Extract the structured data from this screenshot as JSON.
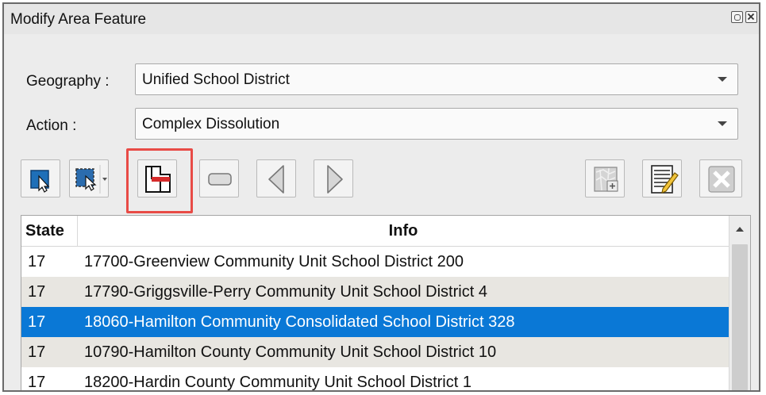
{
  "window": {
    "title": "Modify Area Feature",
    "float_icon": "float-icon",
    "close_icon": "close-icon"
  },
  "form": {
    "geography_label": "Geography :",
    "geography_value": "Unified School District",
    "action_label": "Action :",
    "action_value": "Complex Dissolution"
  },
  "toolbar": {
    "tools": [
      "select-feature-icon",
      "select-area-icon",
      "complex-dissolution-icon",
      "blank-icon",
      "previous-icon",
      "next-icon",
      "map-icon",
      "edit-list-icon",
      "cancel-icon"
    ],
    "highlight_color": "#e84b46"
  },
  "table": {
    "columns": [
      "State",
      "Info"
    ],
    "rows": [
      {
        "state": "17",
        "info": "17700-Greenview Community Unit School District 200"
      },
      {
        "state": "17",
        "info": "17790-Griggsville-Perry Community Unit School District 4"
      },
      {
        "state": "17",
        "info": "18060-Hamilton Community Consolidated School District 328"
      },
      {
        "state": "17",
        "info": "10790-Hamilton County Community Unit School District 10"
      },
      {
        "state": "17",
        "info": "18200-Hardin County Community Unit School District 1"
      }
    ],
    "selected_row": 2,
    "selection_color": "#0a78d6"
  }
}
